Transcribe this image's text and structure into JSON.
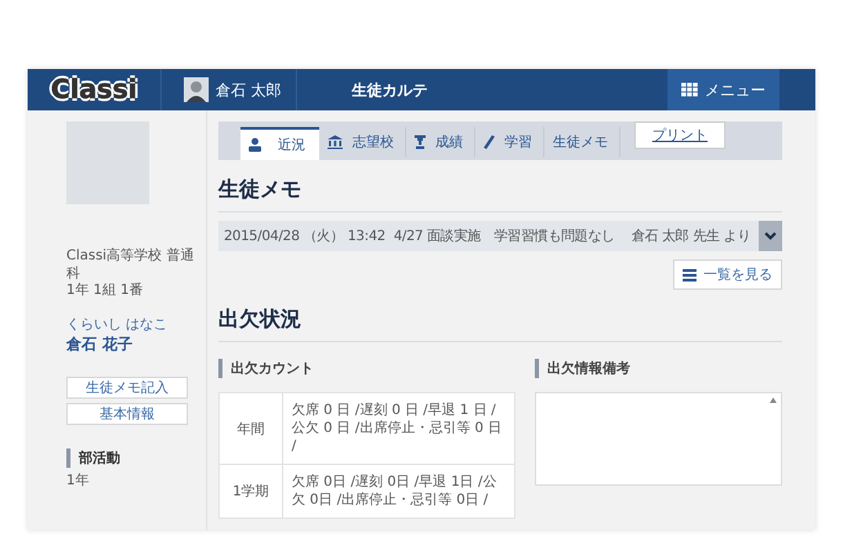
{
  "header": {
    "logo": "Classi",
    "user": "倉石 太郎",
    "title": "生徒カルテ",
    "menu": "メニュー"
  },
  "student": {
    "school": "Classi高等学校 普通科",
    "class": "1年 1組 1番",
    "kana": "くらいし はなこ",
    "name": "倉石 花子"
  },
  "side_buttons": [
    "生徒メモ記入",
    "基本情報"
  ],
  "club": {
    "heading": "部活動",
    "year": "1年"
  },
  "tabs": [
    {
      "label": "近況",
      "selected": true
    },
    {
      "label": "志望校",
      "selected": false
    },
    {
      "label": "成績",
      "selected": false
    },
    {
      "label": "学習",
      "selected": false
    },
    {
      "label": "生徒メモ",
      "selected": false
    }
  ],
  "print_button": "プリント",
  "memo": {
    "heading": "生徒メモ",
    "date": "2015/04/28 （火） 13:42",
    "text": "4/27 面談実施　学習習慣も問題なし",
    "author": "倉石 太郎 先生 より",
    "list_button": "一覧を見る"
  },
  "attendance": {
    "heading": "出欠状況",
    "count_heading": "出欠カウント",
    "remarks_heading": "出欠情報備考",
    "rows": [
      {
        "period": "年間",
        "counts": "欠席 0 日 /遅刻 0 日 /早退 1 日 /公欠 0 日 /出席停止・忌引等 0 日 /"
      },
      {
        "period": "1学期",
        "counts": "欠席 0日 /遅刻 0日 /早退 1日 /公欠 0日 /出席停止・忌引等 0日 /"
      }
    ]
  }
}
